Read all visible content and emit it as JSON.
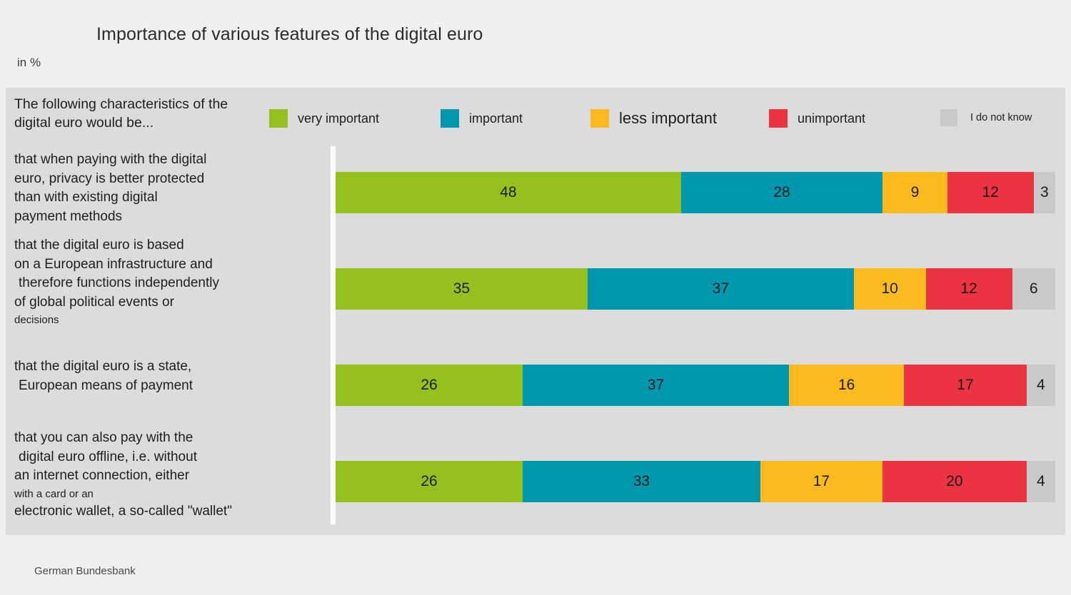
{
  "header": {
    "title": "Importance of various features of the digital euro",
    "unit": "in %"
  },
  "legend": {
    "question": "The following characteristics of the digital euro would be...",
    "items": [
      {
        "label": "very important",
        "color": "#95c11f"
      },
      {
        "label": "important",
        "color": "#0098ae"
      },
      {
        "label": "less important",
        "color": "#fbba1d"
      },
      {
        "label": "unimportant",
        "color": "#ec3341"
      },
      {
        "label": "I do not know",
        "color": "#c9c9c9"
      }
    ]
  },
  "categories_wrapped": [
    [
      {
        "text": "that when paying with the digital",
        "size": "normal",
        "indent": false
      },
      {
        "text": "euro, privacy is better protected",
        "size": "normal",
        "indent": false
      },
      {
        "text": "than with existing digital",
        "size": "normal",
        "indent": false
      },
      {
        "text": "payment methods",
        "size": "normal",
        "indent": false
      }
    ],
    [
      {
        "text": "that the digital euro is based",
        "size": "normal",
        "indent": false
      },
      {
        "text": "on a European infrastructure and",
        "size": "normal",
        "indent": false
      },
      {
        "text": "therefore functions independently",
        "size": "normal",
        "indent": true
      },
      {
        "text": "of global political events or",
        "size": "normal",
        "indent": false
      },
      {
        "text": "decisions",
        "size": "small",
        "indent": false
      }
    ],
    [
      {
        "text": "that the digital euro is a state,",
        "size": "normal",
        "indent": false
      },
      {
        "text": "European means of payment",
        "size": "normal",
        "indent": true
      }
    ],
    [
      {
        "text": "that you can also pay with the",
        "size": "normal",
        "indent": false
      },
      {
        "text": "digital euro offline, i.e. without",
        "size": "normal",
        "indent": true
      },
      {
        "text": "an internet connection, either",
        "size": "normal",
        "indent": false
      },
      {
        "text": "with a card or an",
        "size": "small",
        "indent": false
      },
      {
        "text": "electronic wallet, a so-called \"wallet\"",
        "size": "normal",
        "indent": false
      }
    ]
  ],
  "footer": {
    "source": "German Bundesbank"
  },
  "chart_data": {
    "type": "bar",
    "orientation": "horizontal",
    "stacked": true,
    "stack_total": 100,
    "title": "Importance of various features of the digital euro",
    "subtitle": "in %",
    "xlabel": "",
    "ylabel": "",
    "xlim": [
      0,
      100
    ],
    "grid": false,
    "legend_position": "top",
    "categories": [
      "that when paying with the digital euro, privacy is better protected than with existing digital payment methods",
      "that the digital euro is based on a European infrastructure and therefore functions independently of global political events or decisions",
      "that the digital euro is a state, European means of payment",
      "that you can also pay with the digital euro offline, i.e. without an internet connection, either with a card or an electronic wallet, a so-called \"wallet\""
    ],
    "series": [
      {
        "name": "very important",
        "color": "#95c11f",
        "values": [
          48,
          35,
          26,
          26
        ]
      },
      {
        "name": "important",
        "color": "#0098ae",
        "values": [
          28,
          37,
          37,
          33
        ]
      },
      {
        "name": "less important",
        "color": "#fbba1d",
        "values": [
          9,
          10,
          16,
          17
        ]
      },
      {
        "name": "unimportant",
        "color": "#ec3341",
        "values": [
          12,
          12,
          17,
          20
        ]
      },
      {
        "name": "I do not know",
        "color": "#c9c9c9",
        "values": [
          3,
          6,
          4,
          4
        ]
      }
    ],
    "source": "German Bundesbank"
  }
}
